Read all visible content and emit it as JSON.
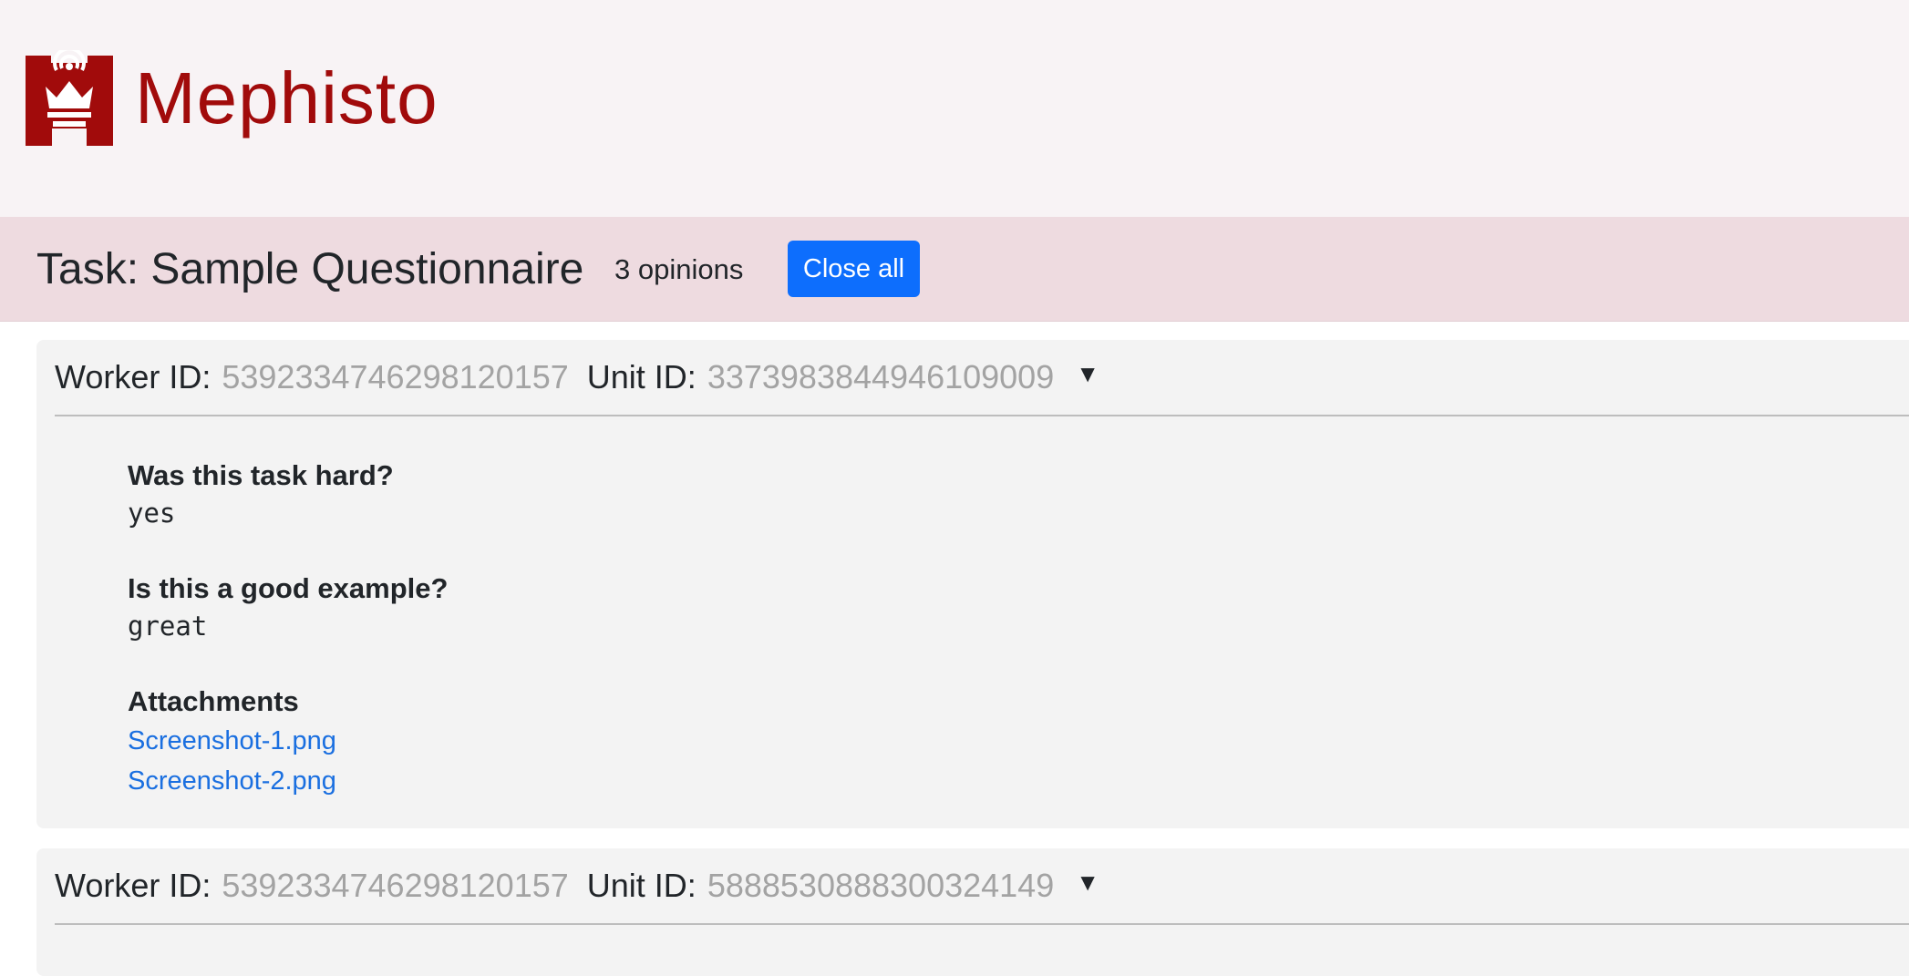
{
  "header": {
    "logo_icon": "mephisto-crown-logo",
    "app_name": "Mephisto",
    "brand_color": "#a10b0b",
    "background_color": "#f8f3f5"
  },
  "task": {
    "title": "Task: Sample Questionnaire",
    "opinions_count": "3 opinions",
    "close_all_label": "Close all",
    "button_color": "#0d6efd",
    "bar_color": "#eedbe0"
  },
  "opinions": [
    {
      "worker_label": "Worker ID:",
      "worker_id": "5392334746298120157",
      "unit_label": "Unit ID:",
      "unit_id": "3373983844946109009",
      "toggle_icon": "triangle-down-icon",
      "toggle_glyph": "▼",
      "questions": [
        {
          "question": "Was this task hard?",
          "answer": "yes"
        },
        {
          "question": "Is this a good example?",
          "answer": "great"
        }
      ],
      "attachments_label": "Attachments",
      "attachments": [
        "Screenshot-1.png",
        "Screenshot-2.png"
      ]
    },
    {
      "worker_label": "Worker ID:",
      "worker_id": "5392334746298120157",
      "unit_label": "Unit ID:",
      "unit_id": "5888530888300324149",
      "toggle_icon": "triangle-down-icon",
      "toggle_glyph": "▼"
    }
  ]
}
